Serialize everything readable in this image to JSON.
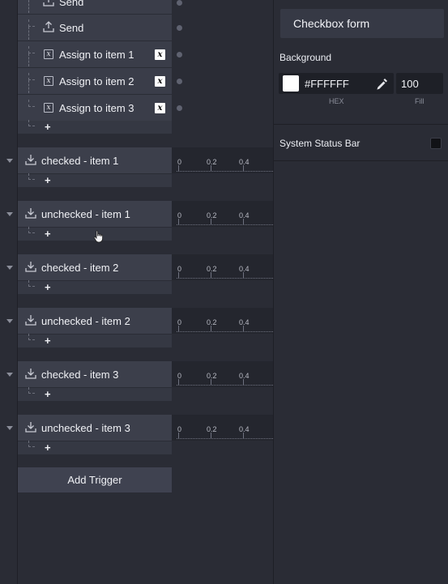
{
  "timeline": {
    "actions": [
      {
        "icon": "upload-icon",
        "label": "Send"
      },
      {
        "icon": "upload-icon",
        "label": "Send"
      },
      {
        "icon": "variable-icon",
        "label": "Assign to item 1",
        "badge": "x"
      },
      {
        "icon": "variable-icon",
        "label": "Assign to item 2",
        "badge": "x"
      },
      {
        "icon": "variable-icon",
        "label": "Assign to item 3",
        "badge": "x"
      }
    ],
    "plus_label": "+",
    "triggers": [
      {
        "label": "checked - item 1"
      },
      {
        "label": "unchecked - item 1"
      },
      {
        "label": "checked - item 2"
      },
      {
        "label": "unchecked - item 2"
      },
      {
        "label": "checked - item 3"
      },
      {
        "label": "unchecked - item 3"
      }
    ],
    "ruler_ticks": [
      "0",
      "0.2",
      "0.4"
    ],
    "add_trigger_label": "Add Trigger"
  },
  "inspector": {
    "title": "Checkbox form",
    "background_label": "Background",
    "hex_value": "#FFFFFF",
    "fill_value": "100",
    "hex_caption": "HEX",
    "fill_caption": "Fill",
    "system_status_bar_label": "System Status Bar",
    "system_status_bar_checked": false
  },
  "colors": {
    "panel_bg": "#2a2c35",
    "row_bg": "#3a3d49",
    "input_bg": "#1e2027",
    "swatch": "#FFFFFF"
  }
}
